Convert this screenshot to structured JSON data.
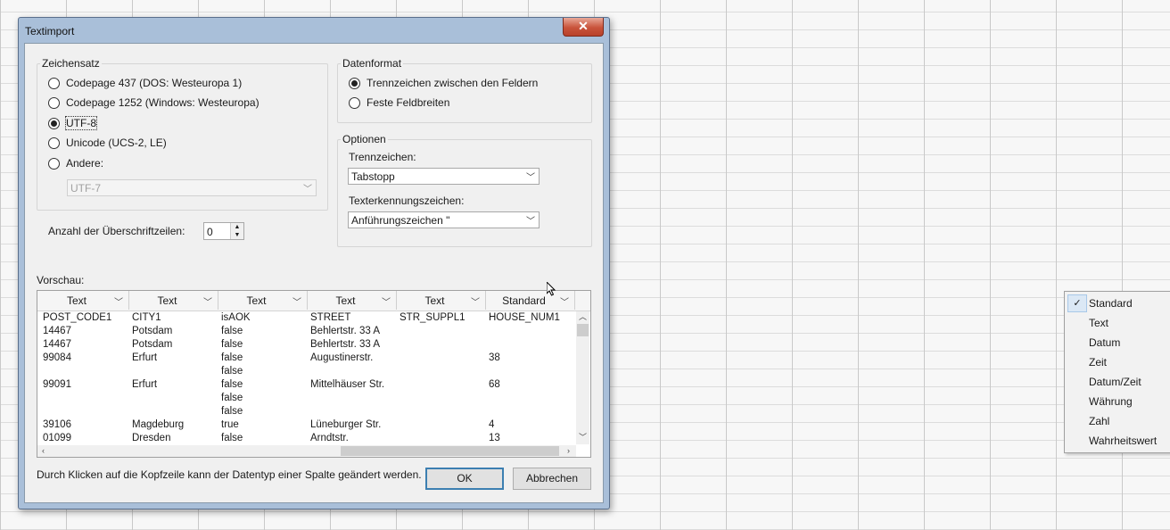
{
  "dialog": {
    "title": "Textimport",
    "close_glyph": "✕",
    "charset": {
      "label": "Zeichensatz",
      "options": [
        {
          "label": "Codepage 437 (DOS: Westeuropa 1)",
          "checked": false
        },
        {
          "label": "Codepage 1252 (Windows: Westeuropa)",
          "checked": false
        },
        {
          "label": "UTF-8",
          "checked": true
        },
        {
          "label": "Unicode (UCS-2, LE)",
          "checked": false
        },
        {
          "label": "Andere:",
          "checked": false
        }
      ],
      "other_value": "UTF-7"
    },
    "header_rows": {
      "label": "Anzahl der Überschriftzeilen:",
      "value": "0"
    },
    "format": {
      "label": "Datenformat",
      "options": [
        {
          "label": "Trennzeichen zwischen den Feldern",
          "checked": true
        },
        {
          "label": "Feste Feldbreiten",
          "checked": false
        }
      ]
    },
    "options": {
      "label": "Optionen",
      "delimiter_label": "Trennzeichen:",
      "delimiter_value": "Tabstopp",
      "qualifier_label": "Texterkennungszeichen:",
      "qualifier_value": "Anführungszeichen \""
    },
    "preview": {
      "label": "Vorschau:",
      "column_types": [
        "Text",
        "Text",
        "Text",
        "Text",
        "Text",
        "Standard"
      ],
      "rows": [
        [
          "POST_CODE1",
          "CITY1",
          "isAOK",
          "STREET",
          "STR_SUPPL1",
          "HOUSE_NUM1"
        ],
        [
          "14467",
          "Potsdam",
          "false",
          "Behlertstr. 33 A",
          "",
          ""
        ],
        [
          "14467",
          "Potsdam",
          "false",
          "Behlertstr. 33 A",
          "",
          ""
        ],
        [
          "99084",
          "Erfurt",
          "false",
          "Augustinerstr.",
          "",
          "38"
        ],
        [
          "",
          "",
          "false",
          "",
          "",
          ""
        ],
        [
          "99091",
          "Erfurt",
          "false",
          "Mittelhäuser Str.",
          "",
          "68"
        ],
        [
          "",
          "",
          "false",
          "",
          "",
          ""
        ],
        [
          "",
          "",
          "false",
          "",
          "",
          ""
        ],
        [
          "39106",
          "Magdeburg",
          "true",
          "Lüneburger Str.",
          "",
          "4"
        ],
        [
          "01099",
          "Dresden",
          "false",
          "Arndtstr.",
          "",
          "13"
        ]
      ]
    },
    "hint": "Durch Klicken auf die Kopfzeile kann der Datentyp einer Spalte geändert werden.",
    "ok_label": "OK",
    "cancel_label": "Abbrechen"
  },
  "type_menu": {
    "items": [
      "Standard",
      "Text",
      "Datum",
      "Zeit",
      "Datum/Zeit",
      "Währung",
      "Zahl",
      "Wahrheitswert"
    ],
    "checked": "Standard",
    "check_glyph": "✓"
  }
}
